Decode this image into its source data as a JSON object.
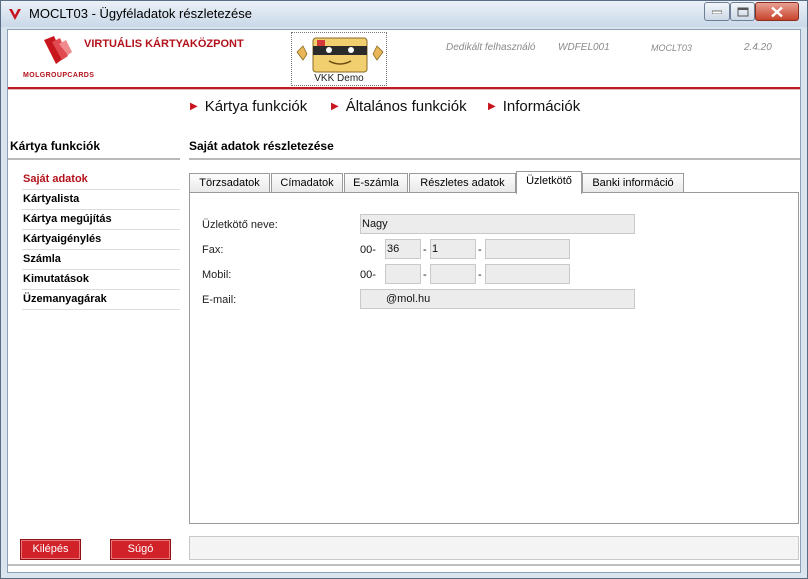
{
  "window": {
    "title": "MOCLT03 - Ügyféladatok részletezése"
  },
  "header": {
    "logo_text": "VIRTUÁLIS KÁRTYAKÖZPONT",
    "logo_sub": "MOLGROUPCARDS",
    "mascot_label": "VKK Demo",
    "user_label": "Dedikált felhasználó",
    "user_id": "WDFEL001",
    "screen_code": "MOCLT03",
    "version": "2.4.20"
  },
  "topnav": [
    {
      "label": "Kártya funkciók"
    },
    {
      "label": "Általános funkciók"
    },
    {
      "label": "Információk"
    }
  ],
  "sidebar": {
    "title": "Kártya funkciók",
    "items": [
      {
        "label": "Saját adatok",
        "active": true
      },
      {
        "label": "Kártyalista"
      },
      {
        "label": "Kártya megújítás"
      },
      {
        "label": "Kártyaigénylés"
      },
      {
        "label": "Számla"
      },
      {
        "label": "Kimutatások"
      },
      {
        "label": "Üzemanyagárak"
      }
    ],
    "exit_label": "Kilépés",
    "help_label": "Súgó"
  },
  "content": {
    "title": "Saját adatok részletezése",
    "tabs": [
      {
        "label": "Törzsadatok"
      },
      {
        "label": "Címadatok"
      },
      {
        "label": "E-számla"
      },
      {
        "label": "Részletes adatok"
      },
      {
        "label": "Üzletkötő",
        "active": true
      },
      {
        "label": "Banki információ"
      }
    ],
    "form": {
      "name_label": "Üzletkötő neve:",
      "name_value": "Nagy",
      "fax_label": "Fax:",
      "fax_prefix": "00-",
      "fax_area": "36",
      "fax_part2": "1",
      "fax_part3": "",
      "mobile_label": "Mobil:",
      "mobile_prefix": "00-",
      "mobile_area": "",
      "mobile_part2": "",
      "mobile_part3": "",
      "email_label": "E-mail:",
      "email_value": "@mol.hu"
    }
  },
  "colors": {
    "brand_red": "#b3121b",
    "button_red": "#d02228"
  }
}
